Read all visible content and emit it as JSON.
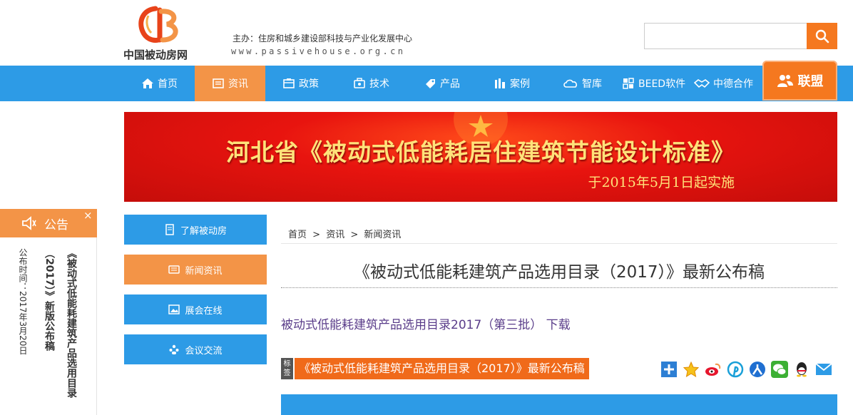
{
  "header": {
    "logo_text": "中国被动房网",
    "sponsor": "主办：住房和城乡建设部科技与产业化发展中心",
    "url": "www.passivehouse.org.cn",
    "search_placeholder": ""
  },
  "nav": {
    "items": [
      {
        "label": "首页",
        "icon": "home-icon"
      },
      {
        "label": "资讯",
        "icon": "news-icon",
        "active": true
      },
      {
        "label": "政策",
        "icon": "policy-icon"
      },
      {
        "label": "技术",
        "icon": "tech-icon"
      },
      {
        "label": "产品",
        "icon": "product-icon"
      },
      {
        "label": "案例",
        "icon": "case-icon"
      },
      {
        "label": "智库",
        "icon": "cloud-icon"
      },
      {
        "label": "BEED软件",
        "icon": "software-icon"
      },
      {
        "label": "中德合作",
        "icon": "handshake-icon"
      }
    ],
    "join_label": "联盟"
  },
  "banner": {
    "title": "河北省《被动式低能耗居住建筑节能设计标准》",
    "subtitle": "于2015年5月1日起实施"
  },
  "notice": {
    "title": "公告",
    "close": "×",
    "line1": "《被动式低能耗建筑产品选用目录",
    "line2": "（2017）》新版公布稿",
    "line3": "公布时间：2017年3月20日"
  },
  "sidebar": {
    "items": [
      {
        "label": "了解被动房"
      },
      {
        "label": "新闻资讯",
        "active": true
      },
      {
        "label": "展会在线"
      },
      {
        "label": "会议交流"
      }
    ]
  },
  "content": {
    "breadcrumb": [
      "首页",
      "资讯",
      "新闻资讯"
    ],
    "breadcrumb_sep": ">",
    "title": "《被动式低能耗建筑产品选用目录（2017）》最新公布稿",
    "download_link": "被动式低能耗建筑产品选用目录2017（第三批） 下载",
    "tag_label": "标签",
    "tag": "《被动式低能耗建筑产品选用目录（2017）》最新公布稿"
  },
  "share": [
    "add-share-icon",
    "qzone-icon",
    "weibo-icon",
    "pinterest-icon",
    "renren-icon",
    "wechat-icon",
    "qq-icon",
    "email-icon"
  ],
  "colors": {
    "nav_blue": "#2d9be6",
    "accent_orange": "#f39447",
    "search_orange": "#f5781f",
    "banner_red": "#e8140f"
  }
}
